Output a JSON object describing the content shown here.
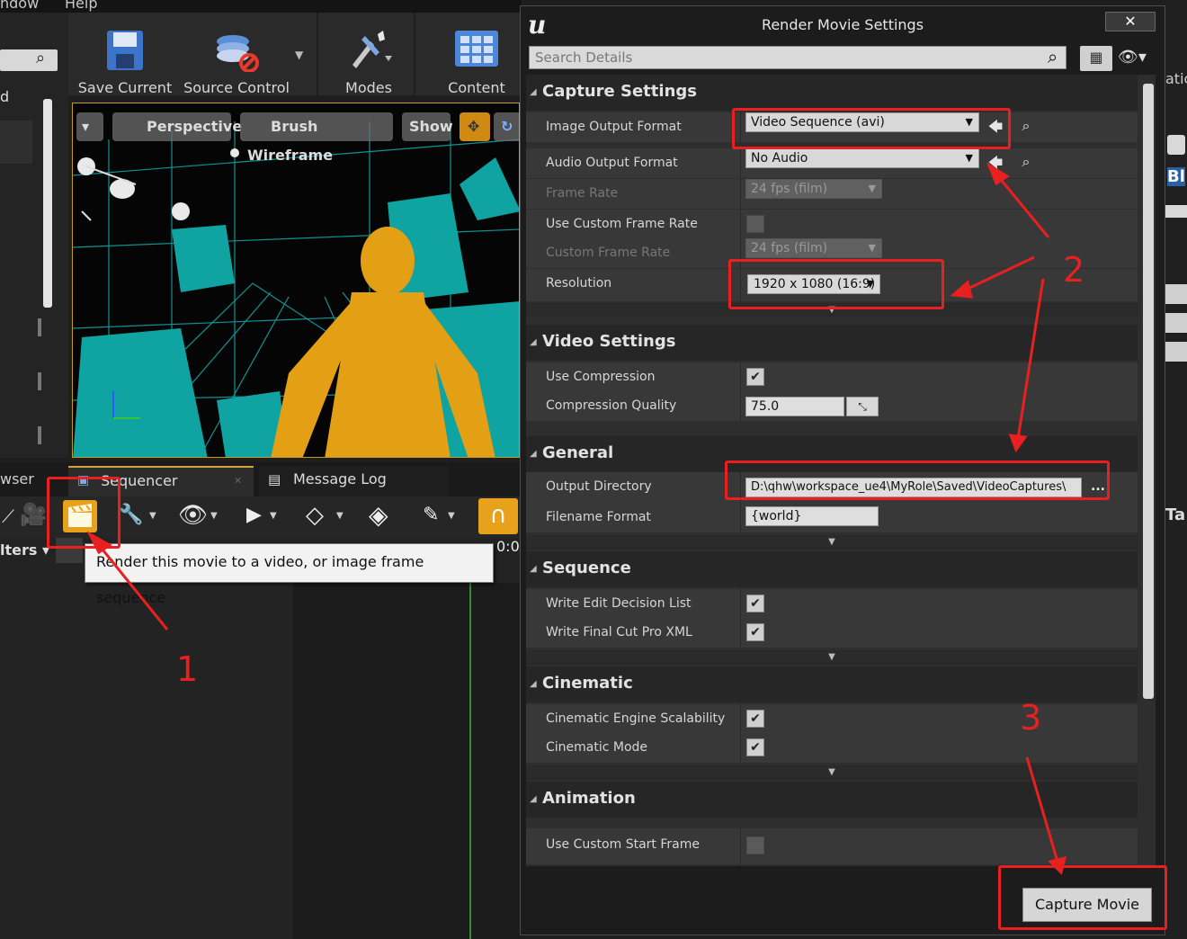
{
  "menubar": {
    "window": "ndow",
    "help": "Help"
  },
  "toolbar": {
    "save_current": "Save Current",
    "source_control": "Source Control",
    "modes": "Modes",
    "content": "Content"
  },
  "viewport": {
    "perspective": "Perspective",
    "brush_wireframe": "Brush Wireframe",
    "show": "Show"
  },
  "left_panel": {
    "browser_tab": "wser",
    "filters": "lters ▾",
    "d_label": "d"
  },
  "sequencer": {
    "tab_sequencer": "Sequencer",
    "tab_message_log": "Message Log",
    "time_readout": "0:0",
    "tooltip": "Render this movie to a video, or image frame sequence"
  },
  "right_strip": {
    "bl": "Bl",
    "ta": "Ta",
    "atic": "atic"
  },
  "dialog": {
    "title": "Render Movie Settings",
    "close": "✕",
    "search_placeholder": "Search Details",
    "capture_settings": {
      "header": "Capture Settings",
      "image_output_format_label": "Image Output Format",
      "image_output_format_value": "Video Sequence (avi)",
      "audio_output_format_label": "Audio Output Format",
      "audio_output_format_value": "No Audio",
      "frame_rate_label": "Frame Rate",
      "frame_rate_value": "24 fps (film)",
      "use_custom_frame_rate_label": "Use Custom Frame Rate",
      "use_custom_frame_rate_checked": false,
      "custom_frame_rate_label": "Custom Frame Rate",
      "custom_frame_rate_value": "24 fps (film)",
      "resolution_label": "Resolution",
      "resolution_value": "1920 x 1080 (16:9)"
    },
    "video_settings": {
      "header": "Video Settings",
      "use_compression_label": "Use Compression",
      "use_compression_checked": true,
      "compression_quality_label": "Compression Quality",
      "compression_quality_value": "75.0"
    },
    "general": {
      "header": "General",
      "output_directory_label": "Output Directory",
      "output_directory_value": "D:\\qhw\\workspace_ue4\\MyRole\\Saved\\VideoCaptures\\",
      "browse": "...",
      "filename_format_label": "Filename Format",
      "filename_format_value": "{world}"
    },
    "sequence": {
      "header": "Sequence",
      "write_edl_label": "Write Edit Decision List",
      "write_edl_checked": true,
      "write_fcp_label": "Write Final Cut Pro XML",
      "write_fcp_checked": true
    },
    "cinematic": {
      "header": "Cinematic",
      "engine_scalability_label": "Cinematic Engine Scalability",
      "engine_scalability_checked": true,
      "cinematic_mode_label": "Cinematic Mode",
      "cinematic_mode_checked": true
    },
    "animation": {
      "header": "Animation",
      "use_custom_start_frame_label": "Use Custom Start Frame",
      "use_custom_start_frame_checked": false
    },
    "capture_movie": "Capture Movie"
  },
  "annotations": {
    "step1": "1",
    "step2": "2",
    "step3": "3"
  },
  "colors": {
    "annotation_red": "#e8201f",
    "accent_orange": "#e8a11a",
    "wire_teal": "#13a3a3"
  }
}
